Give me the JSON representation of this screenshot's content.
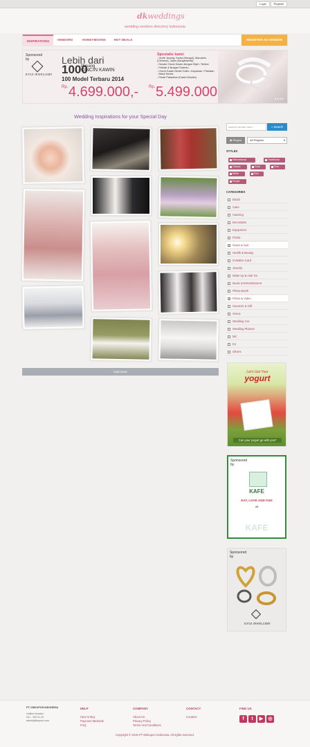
{
  "topbar": {
    "login": "Login",
    "register": "Register"
  },
  "header": {
    "logo_prefix": "dk",
    "logo_name": "weddings",
    "tagline": "wedding vendors directory Indonesia"
  },
  "nav": {
    "items": [
      {
        "label": "INSPIRATIONS",
        "active": true
      },
      {
        "label": "VENDORS"
      },
      {
        "label": "HONEYMOONS"
      },
      {
        "label": "HOT DEALS"
      }
    ],
    "register_vendor": "REGISTER AS VENDOR"
  },
  "banner": {
    "sponsored": "Sponsored",
    "by": "by",
    "brand": "KYLE JEWELLERY",
    "headline": "Lebih dari",
    "count": "1000",
    "count_line1": "Pasang",
    "count_line2": "CINCIN KAWIN",
    "models": "100 Model Terbaru 2014",
    "rp1_label": "Rp.",
    "rp1": "4.699.000,-",
    "rp2_label": "Rp.",
    "rp2": "5.499.000,-",
    "spec_title": "Spesialis kami:",
    "spec_lines": [
      "- Grafir Jeyung, Korea (Hangul), Mandarin",
      "  (Chinese), Jawa (Sangsekerta)",
      "- Desain Cincin Kawin dengan Style / Selera",
      "- Pribadi & Budget Tertentu",
      "- Cincin Kawin Model Celtic / Anyaman / Pahatan",
      "- Black Series",
      "- Perak Palladium (Kawin Muslim)"
    ],
    "dots": "● ● ● ●"
  },
  "section_title": "Wedding Inspirations for your Special Day",
  "load_more": "load more",
  "sidebar": {
    "search_placeholder": "search vendor here...",
    "search_button": "Search",
    "region_button": "Region",
    "region_value": "All Regions",
    "styles_label": "STYLES",
    "styles": [
      "International",
      "Traditional",
      "Classic",
      "Gold",
      "Pink",
      "White",
      "Red",
      "Purple"
    ],
    "categories_label": "CATEGORIES",
    "categories": [
      {
        "label": "Bridal",
        "checked": false
      },
      {
        "label": "Cake",
        "checked": false
      },
      {
        "label": "Catering",
        "checked": false
      },
      {
        "label": "Decoration",
        "checked": false
      },
      {
        "label": "Equipment",
        "checked": false
      },
      {
        "label": "Florist",
        "checked": false
      },
      {
        "label": "Gown & Suit",
        "checked": true
      },
      {
        "label": "Health & Beauty",
        "checked": false
      },
      {
        "label": "Invitation Card",
        "checked": false
      },
      {
        "label": "Jewelry",
        "checked": false
      },
      {
        "label": "Make Up & Hair Do",
        "checked": false
      },
      {
        "label": "Music & Entertainment",
        "checked": false
      },
      {
        "label": "Photo Booth",
        "checked": false
      },
      {
        "label": "Photo & Video",
        "checked": true
      },
      {
        "label": "Souvenir & Gift",
        "checked": false
      },
      {
        "label": "Venue",
        "checked": false
      },
      {
        "label": "Wedding Car",
        "checked": false
      },
      {
        "label": "Wedding Planner",
        "checked": false
      },
      {
        "label": "MC",
        "checked": false
      },
      {
        "label": "DJ",
        "checked": false
      },
      {
        "label": "Others",
        "checked": false
      }
    ]
  },
  "ads": {
    "yogurt_title": "Let's Get Your",
    "yogurt_brand": "yogurt",
    "yogurt_tag": "Can your yogurt go with you?",
    "kafe_sponsored": "Sponsored",
    "kafe_by": "by",
    "kafe_brand": "KAFE",
    "kafe_line": "EAT, LOVE AND FUN",
    "kafe_at": "at",
    "kj_sponsored": "Sponsored",
    "kj_by": "by",
    "kj_brand": "KYLE JEWELLERY"
  },
  "footer": {
    "company": "PT. DISKUPON INDONESIA",
    "hotline_label": "Hotline Number",
    "hotline": "021 - 332 01 22",
    "email": "admin@dkupon.com",
    "help_title": "HELP",
    "help_links": [
      "How to Buy",
      "Payment Methods",
      "FAQ"
    ],
    "company_title": "COMPANY",
    "company_links": [
      "About Us",
      "Privacy Policy",
      "Terms And Conditions"
    ],
    "contact_title": "CONTACT",
    "contact_links": [
      "Location"
    ],
    "find_title": "FIND US",
    "copyright": "Copyright © 2015 PT Diskupon Indonesia. All rights reserved."
  }
}
